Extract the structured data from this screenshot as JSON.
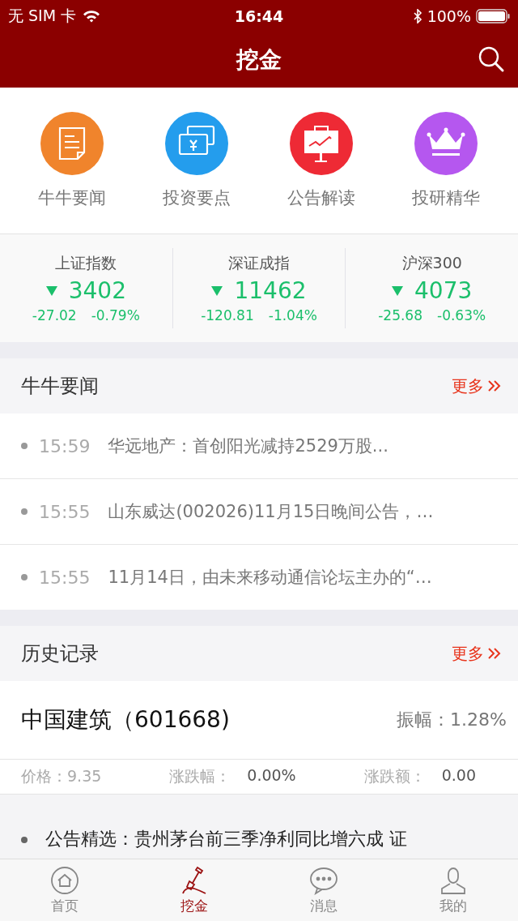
{
  "status_bar": {
    "carrier": "无 SIM 卡",
    "time": "16:44",
    "battery": "100%"
  },
  "nav": {
    "title": "挖金"
  },
  "shortcuts": [
    {
      "label": "牛牛要闻",
      "kind": "news",
      "color": "#f0842c"
    },
    {
      "label": "投资要点",
      "kind": "money",
      "color": "#249ded"
    },
    {
      "label": "公告解读",
      "kind": "board",
      "color": "#ee2a35"
    },
    {
      "label": "投研精华",
      "kind": "crown",
      "color": "#b557ef"
    }
  ],
  "indices": [
    {
      "name": "上证指数",
      "value": "3402",
      "change": "-27.02",
      "percent": "-0.79%",
      "falling": true
    },
    {
      "name": "深证成指",
      "value": "11462",
      "change": "-120.81",
      "percent": "-1.04%",
      "falling": true
    },
    {
      "name": "沪深300",
      "value": "4073",
      "change": "-25.68",
      "percent": "-0.63%",
      "falling": true
    }
  ],
  "news": {
    "title": "牛牛要闻",
    "more": "更多",
    "items": [
      {
        "time": "15:59",
        "text": "华远地产：首创阳光减持2529万股..."
      },
      {
        "time": "15:55",
        "text": "山东威达(002026)11月15日晚间公告，…"
      },
      {
        "time": "15:55",
        "text": "11月14日，由未来移动通信论坛主办的“…"
      }
    ]
  },
  "history": {
    "title": "历史记录",
    "more": "更多",
    "stock": "中国建筑（601668)",
    "amplitude": "振幅：1.28%",
    "price": "价格：9.35",
    "change_pct_label": "涨跌幅：",
    "change_pct": "0.00%",
    "change_amt_label": "涨跌额：",
    "change_amt": "0.00",
    "note": "公告精选：贵州茅台前三季净利同比增六成 证"
  },
  "tabs": [
    {
      "label": "首页",
      "kind": "home",
      "selected": false
    },
    {
      "label": "挖金",
      "kind": "shovel",
      "selected": true
    },
    {
      "label": "消息",
      "kind": "chat",
      "selected": false
    },
    {
      "label": "我的",
      "kind": "person",
      "selected": false
    }
  ]
}
